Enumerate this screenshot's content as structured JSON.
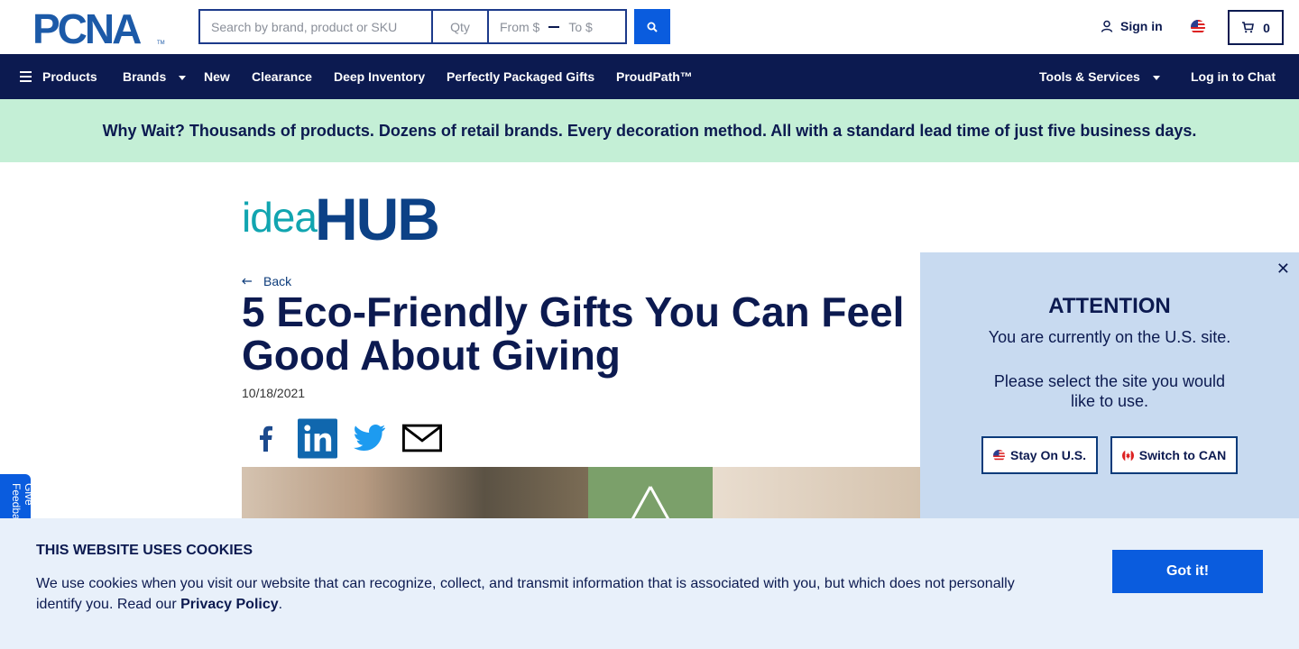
{
  "header": {
    "logo_text": "PCNA",
    "search_placeholder": "Search by brand, product or SKU",
    "qty_placeholder": "Qty",
    "from_placeholder": "From $",
    "to_placeholder": "To $",
    "signin_label": "Sign in",
    "cart_count": "0"
  },
  "nav": {
    "products": "Products",
    "brands": "Brands",
    "new": "New",
    "clearance": "Clearance",
    "deep_inventory": "Deep Inventory",
    "gifts": "Perfectly Packaged Gifts",
    "proudpath": "ProudPath™",
    "tools": "Tools & Services",
    "chat": "Log in to Chat"
  },
  "promo": {
    "text": "Why Wait? Thousands of products. Dozens of retail brands. Every decoration method. All with a standard lead time of just five business days."
  },
  "article": {
    "logo_idea": "idea",
    "logo_hub": "HUB",
    "back_label": "Back",
    "title": "5 Eco-Friendly Gifts You Can Feel Good About Giving",
    "date": "10/18/2021"
  },
  "feedback": {
    "label": "Give Feedback"
  },
  "attention": {
    "heading": "ATTENTION",
    "line1": "You are currently on the U.S. site.",
    "line2": "Please select the site you would like to use.",
    "stay_label": "Stay On U.S.",
    "switch_label": "Switch to CAN"
  },
  "cookie": {
    "heading": "THIS WEBSITE USES COOKIES",
    "body": "We use cookies when you visit our website that can recognize, collect, and transmit information that is associated with you, but which does not personally identify you. Read our",
    "link": "Privacy Policy",
    "period": ".",
    "button": "Got it!"
  },
  "colors": {
    "navy": "#0c1a50",
    "accent_blue": "#0a5cde",
    "promo_green": "#c4efd6",
    "panel_blue": "#c8daf0",
    "cookie_bg": "#e8f0fa"
  }
}
